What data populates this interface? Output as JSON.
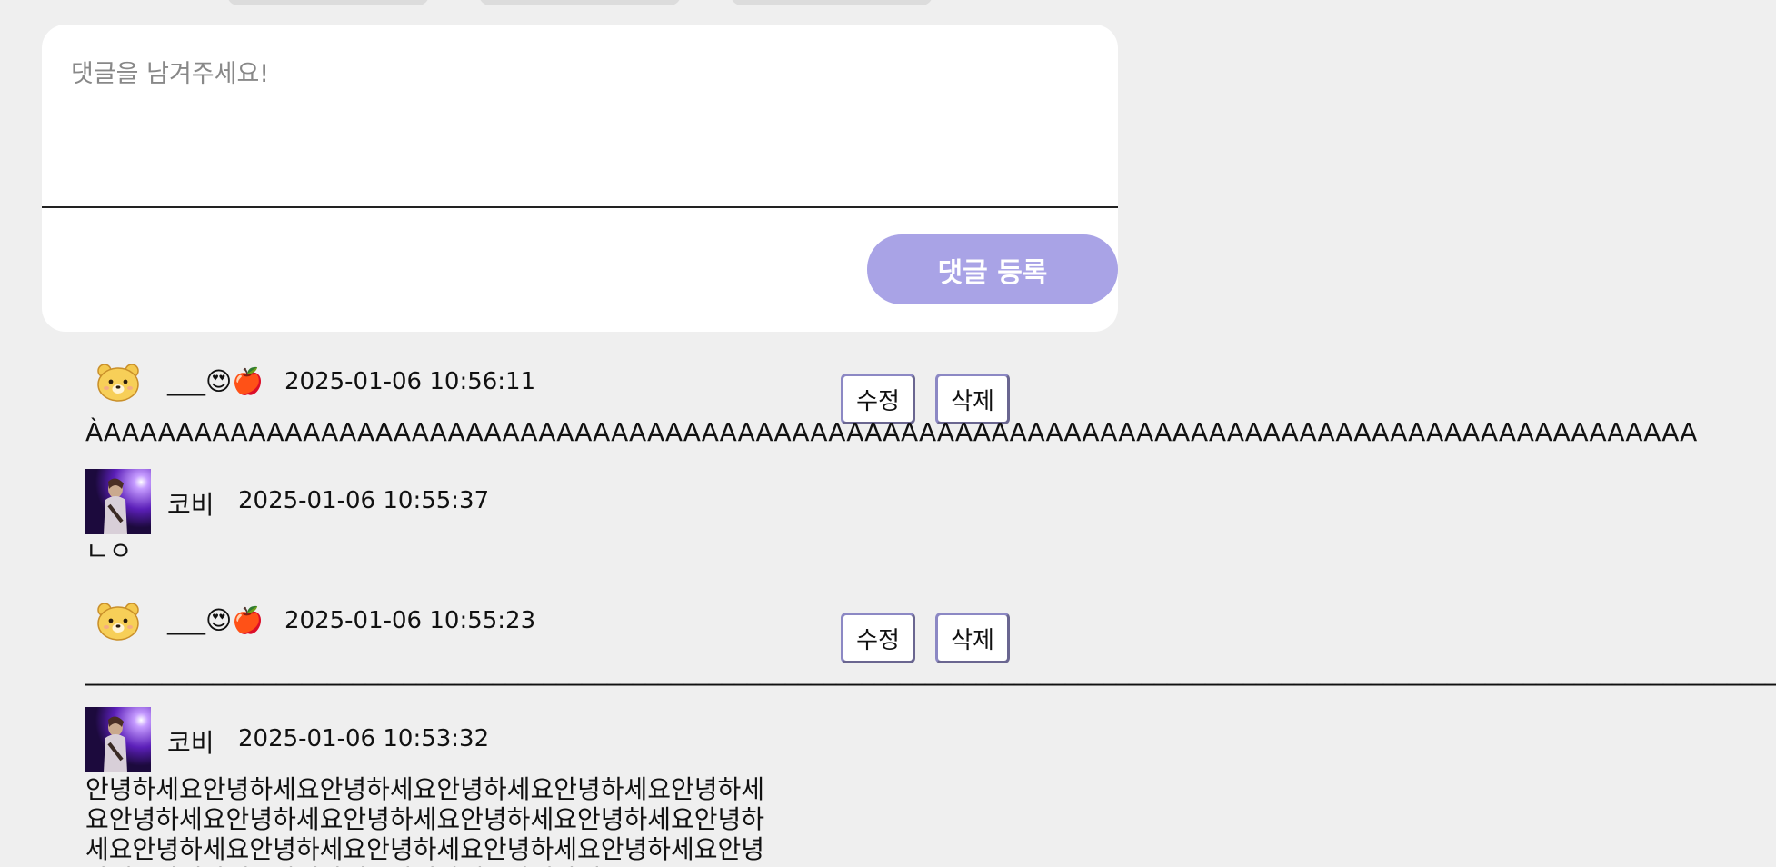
{
  "form": {
    "placeholder": "댓글을 남겨주세요!",
    "submit_label": "댓글 등록"
  },
  "comments": [
    {
      "author": "___😍🍎",
      "date": "2025-01-06 10:56:11",
      "body": "ÀAAAAAAAAAAAAAAAAAAAAAAAAAAAAAAAAAAAAAAAAAAAAAAAAAAAAAAAAAAAAAAAAAAAAAAAAAAAAAAAAAAAAAAAA",
      "edit_label": "수정",
      "delete_label": "삭제",
      "avatar": "bear-avatar-icon"
    },
    {
      "author": "코비",
      "date": "2025-01-06 10:55:37",
      "body": "ㄴㅇ",
      "avatar": "concert-photo"
    },
    {
      "author": "___😍🍎",
      "date": "2025-01-06 10:55:23",
      "body": "________________________________________________________________________________________________________________________________________________________________________________________________",
      "edit_label": "수정",
      "delete_label": "삭제",
      "avatar": "bear-avatar-icon"
    },
    {
      "author": "코비",
      "date": "2025-01-06 10:53:32",
      "body": "안녕하세요안녕하세요안녕하세요안녕하세요안녕하세요안녕하세요안녕하세요안녕하세요안녕하세요안녕하세요안녕하세요안녕하세요안녕하세요안녕하세요안녕하세요안녕하세요안녕하세요안녕하세요안녕하세요안녕하세요안녕하세요안녕하세요",
      "avatar": "concert-photo"
    }
  ],
  "colors": {
    "background": "#efefef",
    "submit_button": "#a9a3e6",
    "action_border": "#8c88c4"
  }
}
